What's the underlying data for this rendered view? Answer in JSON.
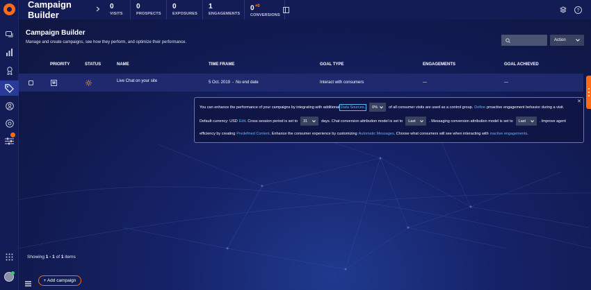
{
  "app": {
    "title": "Campaign Builder"
  },
  "metrics": [
    {
      "value": "0",
      "label": "VISITS",
      "delta": ""
    },
    {
      "value": "0",
      "label": "PROSPECTS",
      "delta": ""
    },
    {
      "value": "0",
      "label": "EXPOSURES",
      "delta": ""
    },
    {
      "value": "1",
      "label": "ENGAGEMENTS",
      "delta": ""
    },
    {
      "value": "0",
      "label": "CONVERSIONS",
      "delta": "+0"
    }
  ],
  "page": {
    "title": "Campaign Builder",
    "subtitle": "Manage and create campaigns, see how they perform, and optimize their performance."
  },
  "toolbar": {
    "search_placeholder": "",
    "action_label": "Action"
  },
  "table": {
    "headers": {
      "priority": "PRIORITY",
      "status": "STATUS",
      "name": "NAME",
      "timeframe": "TIME FRAME",
      "goal_type": "GOAL TYPE",
      "engagements": "ENGAGEMENTS",
      "goal_achieved": "GOAL ACHIEVED"
    },
    "rows": [
      {
        "priority": "M",
        "name": "Live Chat on your site",
        "start": "5 Oct. 2019",
        "separator": "-",
        "end": "No end date",
        "goal_type": "Interact with consumers",
        "engagements": "—",
        "goal_achieved": "—"
      }
    ]
  },
  "info": {
    "l1_a": "You can enhance the performance of your campaigns by integrating with additional",
    "l1_link": "Data Sources.",
    "l1_select": "0%",
    "l1_b": "of all consumer visits are used as a control group.",
    "l1_link2": "Define",
    "l1_c": "proactive engagement behavior during a visit.",
    "l2_a": "Default currency: USD",
    "l2_link": "Edit",
    "l2_b": ". Cross session period is set to",
    "l2_select": "31",
    "l2_c": "days. Chat conversion attribution model is set to",
    "l2_select2": "Last",
    "l2_d": ". Messaging conversion attribution model is set to",
    "l2_select3": "Last",
    "l2_e": ". Improve agent",
    "l3_a": "efficiency by creating",
    "l3_link": "Predefined Content",
    "l3_b": ". Enhance the consumer experience by customizing",
    "l3_link2": "Automatic Messages",
    "l3_c": ". Choose what consumers will see when interacting with",
    "l3_link3": "inactive engagements",
    "l3_d": ".",
    "close": "✕"
  },
  "footer": {
    "showing_prefix": "Showing",
    "range": "1 - 1",
    "of": "of",
    "total": "1",
    "items": "items",
    "add_label": "+ Add campaign"
  },
  "colors": {
    "accent": "#ff6a13",
    "link": "#5eb7f7",
    "background": "#0f1640"
  }
}
